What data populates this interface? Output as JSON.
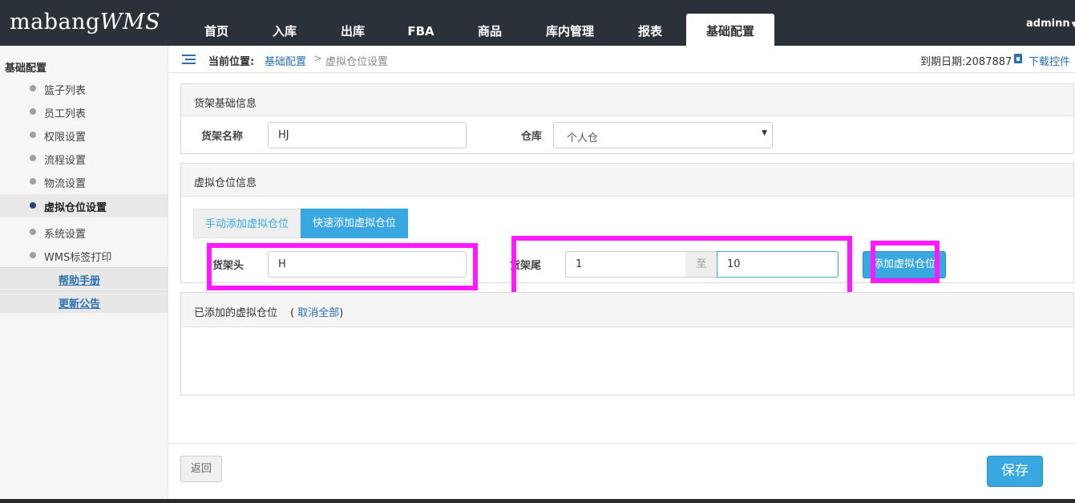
{
  "app": {
    "logo_main": "mabang",
    "logo_wms": "WMS"
  },
  "nav": {
    "items": [
      "首页",
      "入库",
      "出库",
      "FBA",
      "商品",
      "库内管理",
      "报表",
      "基础配置"
    ],
    "active_index": 7,
    "user": "adminn"
  },
  "sidebar": {
    "title": "基础配置",
    "items": [
      "篮子列表",
      "员工列表",
      "权限设置",
      "流程设置",
      "物流设置",
      "虚拟仓位设置",
      "系统设置",
      "WMS标签打印"
    ],
    "active_index": 5,
    "links": [
      "帮助手册",
      "更新公告"
    ]
  },
  "breadcrumb": {
    "label": "当前位置:",
    "parent": "基础配置",
    "separator": ">",
    "current": "虚拟仓位设置",
    "expiry": "到期日期:2087887",
    "download": "下载控件"
  },
  "shelf_basic": {
    "title": "货架基础信息",
    "name_label": "货架名称",
    "name_value": "HJ",
    "warehouse_label": "仓库",
    "warehouse_value": "个人仓"
  },
  "virtual_slot": {
    "title": "虚拟仓位信息",
    "tab_manual": "手动添加虚拟仓位",
    "tab_quick": "快速添加虚拟仓位",
    "head_label": "货架头",
    "head_value": "H",
    "tail_label": "货架尾",
    "tail_from": "1",
    "range_sep": "至",
    "tail_to": "10",
    "add_button": "添加虚拟仓位"
  },
  "added": {
    "title": "已添加的虚拟仓位",
    "paren_open": "(",
    "cancel_all": "取消全部",
    "paren_close": ")"
  },
  "footer": {
    "back": "返回",
    "save": "保存"
  },
  "colors": {
    "accent": "#3aa8e0",
    "nav_bg": "#2b3138",
    "highlight": "#ff19ff",
    "link": "#2a6fb0"
  }
}
